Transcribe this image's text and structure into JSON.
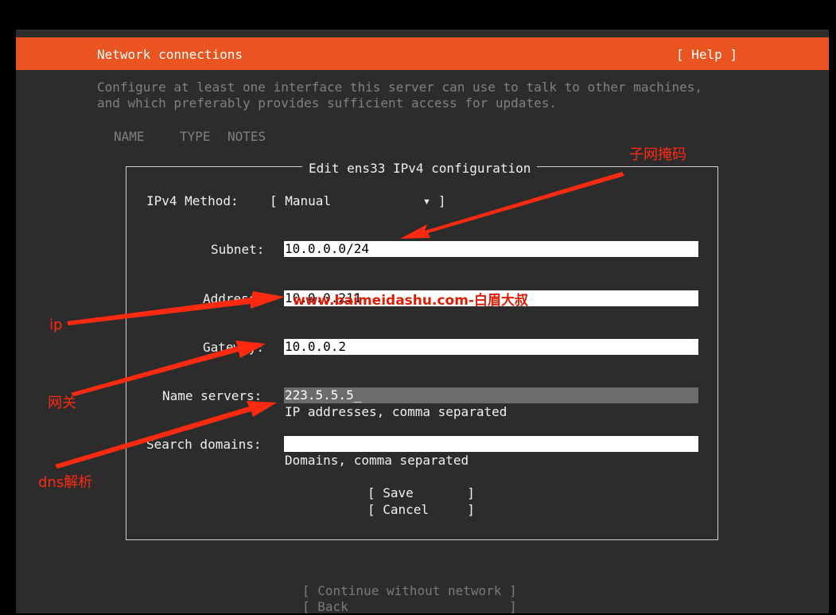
{
  "header": {
    "title": "Network connections",
    "help_label": "[ Help ]"
  },
  "intro": {
    "line1": "Configure at least one interface this server can use to talk to other machines,",
    "line2": "and which preferably provides sufficient access for updates."
  },
  "table_headers": [
    "NAME",
    "TYPE",
    "NOTES"
  ],
  "dialog": {
    "title": "Edit ens33 IPv4 configuration",
    "method_label": "IPv4 Method:",
    "method_value": "[ Manual            ▾ ]",
    "subnet_label": "Subnet:",
    "subnet_value": "10.0.0.0/24",
    "address_label": "Address:",
    "address_value": "10.0.0.211",
    "gateway_label": "Gateway:",
    "gateway_value": "10.0.0.2",
    "nameservers_label": "Name servers:",
    "nameservers_value": "223.5.5.5_",
    "nameservers_hint": "IP addresses, comma separated",
    "search_label": "Search domains:",
    "search_value": "",
    "search_hint": "Domains, comma separated",
    "save_label": "[ Save       ]",
    "cancel_label": "[ Cancel     ]"
  },
  "footer": {
    "continue_label": "[ Continue without network ]",
    "back_label": "[ Back                     ]"
  },
  "annotations": {
    "subnet_mask": "子网掩码",
    "ip": "ip",
    "gateway": "网关",
    "dns": "dns解析",
    "watermark": "www.baimeidashu.com-白眉大叔"
  },
  "colors": {
    "accent": "#e95420",
    "background": "#2c2c2c",
    "annotation": "#ff2a10"
  }
}
